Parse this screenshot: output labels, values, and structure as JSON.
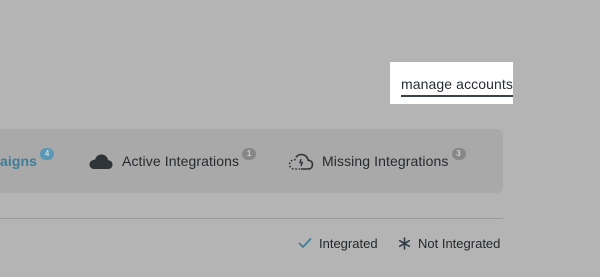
{
  "header": {
    "manage_accounts_label": "manage accounts"
  },
  "tabs": [
    {
      "label": "aigns",
      "count": "4",
      "icon": "campaigns"
    },
    {
      "label": "Active Integrations",
      "count": "1",
      "icon": "cloud-icon"
    },
    {
      "label": "Missing Integrations",
      "count": "3",
      "icon": "cloud-dashed-icon"
    }
  ],
  "legend": {
    "integrated_label": "Integrated",
    "not_integrated_label": "Not Integrated",
    "integrated_icon": "check-icon",
    "not_integrated_icon": "asterisk-icon"
  },
  "colors": {
    "overlay": "#b4b4b4",
    "highlight": "#ffffff",
    "active_tab_text": "#3e7e99",
    "text_dark": "#262a2e",
    "integrated_icon": "#3e7e99"
  }
}
